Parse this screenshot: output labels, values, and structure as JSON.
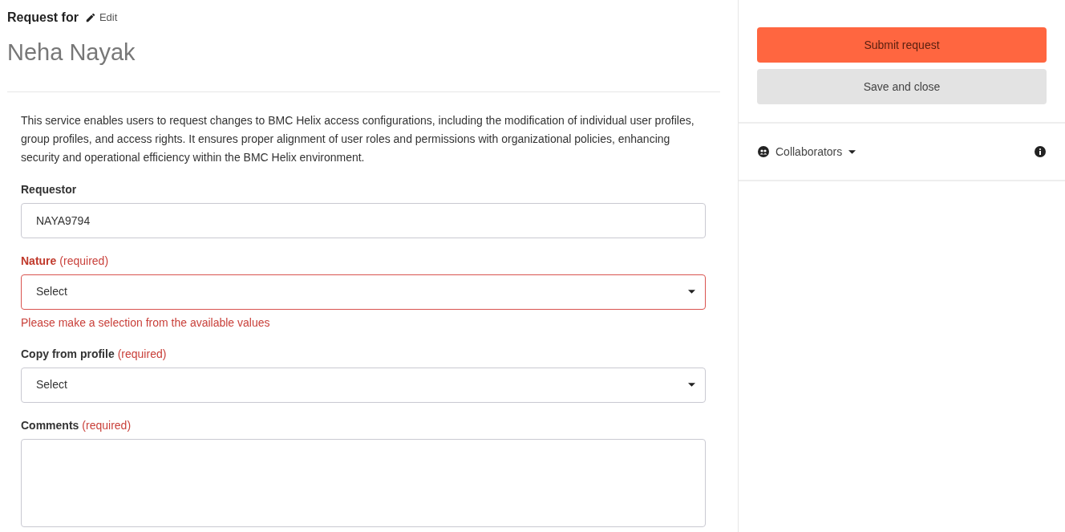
{
  "header": {
    "label": "Request for",
    "edit_link": "Edit",
    "name": "Neha Nayak"
  },
  "description": "This service enables users to request changes to BMC Helix access configurations, including the modification of individual user profiles, group profiles, and access rights. It ensures proper alignment of user roles and permissions with organizational policies, enhancing security and operational efficiency within the BMC Helix environment.",
  "fields": [
    {
      "kind": "text",
      "label": "Requestor",
      "value": "NAYA9794",
      "invalid": false
    },
    {
      "kind": "select",
      "label": "Nature",
      "required_note": "(required)",
      "value": "Select",
      "invalid": true,
      "error_message": "Please make a selection from the available values"
    },
    {
      "kind": "select",
      "label": "Copy from profile",
      "required_note": "(required)",
      "value": "Select",
      "invalid": false
    },
    {
      "kind": "textarea",
      "label": "Comments",
      "required_note": "(required)",
      "invalid": false
    }
  ],
  "actions": [
    {
      "label": "Submit request",
      "kind": "primary"
    },
    {
      "label": "Save and close",
      "kind": "secondary"
    }
  ],
  "collaborators": {
    "label": "Collaborators"
  }
}
